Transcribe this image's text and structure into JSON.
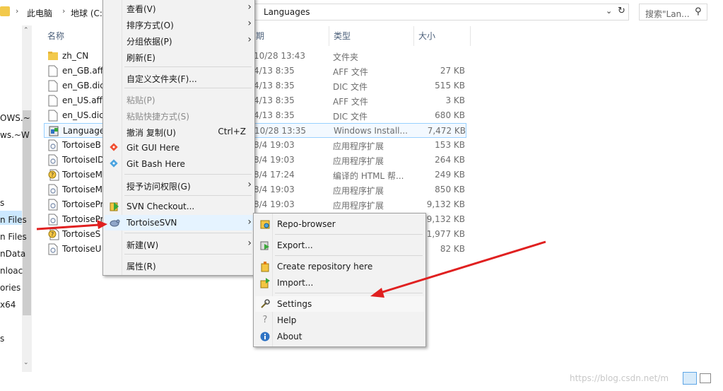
{
  "address": {
    "crumbs": [
      "此电脑",
      "地球 (C:)"
    ],
    "path_tail": "Languages",
    "search_placeholder": "搜索\"Lan..."
  },
  "nav": {
    "items": [
      "OWS.~",
      "ws.~W",
      "s",
      "n Files",
      "n Files",
      "nData",
      "nloac",
      "ories",
      "x64",
      "s"
    ]
  },
  "columns": {
    "name": "名称",
    "date": "期",
    "type": "类型",
    "size": "大小"
  },
  "files": [
    {
      "name": "zh_CN",
      "date": "10/28 13:43",
      "type": "文件夹",
      "size": "",
      "icon": "folder-icon"
    },
    {
      "name": "en_GB.aff",
      "date": "4/13 8:35",
      "type": "AFF 文件",
      "size": "27 KB",
      "icon": "file-icon"
    },
    {
      "name": "en_GB.dic",
      "date": "4/13 8:35",
      "type": "DIC 文件",
      "size": "515 KB",
      "icon": "file-icon"
    },
    {
      "name": "en_US.aff",
      "date": "4/13 8:35",
      "type": "AFF 文件",
      "size": "3 KB",
      "icon": "file-icon"
    },
    {
      "name": "en_US.dic",
      "date": "4/13 8:35",
      "type": "DIC 文件",
      "size": "680 KB",
      "icon": "file-icon"
    },
    {
      "name": "Language",
      "date": "10/28 13:35",
      "type": "Windows Install...",
      "size": "7,472 KB",
      "icon": "installer-icon"
    },
    {
      "name": "TortoiseB",
      "date": "8/4 19:03",
      "type": "应用程序扩展",
      "size": "153 KB",
      "icon": "dll-icon"
    },
    {
      "name": "TortoiseID",
      "date": "8/4 19:03",
      "type": "应用程序扩展",
      "size": "264 KB",
      "icon": "dll-icon"
    },
    {
      "name": "TortoiseM",
      "date": "8/4 17:24",
      "type": "编译的 HTML 帮...",
      "size": "249 KB",
      "icon": "chm-icon"
    },
    {
      "name": "TortoiseM",
      "date": "8/4 19:03",
      "type": "应用程序扩展",
      "size": "850 KB",
      "icon": "dll-icon"
    },
    {
      "name": "TortoisePr",
      "date": "8/4 19:03",
      "type": "应用程序扩展",
      "size": "9,132 KB",
      "icon": "dll-icon"
    },
    {
      "name": "TortoisePr",
      "date": "",
      "type": "",
      "size": "9,132 KB",
      "icon": "dll-icon"
    },
    {
      "name": "TortoiseS",
      "date": "",
      "type": "",
      "size": "1,977 KB",
      "icon": "chm-icon"
    },
    {
      "name": "TortoiseU",
      "date": "",
      "type": "",
      "size": "82 KB",
      "icon": "dll-icon"
    }
  ],
  "context_menu": {
    "items": [
      {
        "label": "查看(V)",
        "arrow": "›"
      },
      {
        "label": "排序方式(O)",
        "arrow": "›"
      },
      {
        "label": "分组依据(P)",
        "arrow": "›"
      },
      {
        "label": "刷新(E)"
      },
      {
        "label": "自定义文件夹(F)..."
      },
      {
        "label": "粘贴(P)"
      },
      {
        "label": "粘贴快捷方式(S)"
      },
      {
        "label": "撤消 复制(U)",
        "accel": "Ctrl+Z"
      },
      {
        "label": "Git GUI Here"
      },
      {
        "label": "Git Bash Here"
      },
      {
        "label": "授予访问权限(G)",
        "arrow": "›"
      },
      {
        "label": "SVN Checkout..."
      },
      {
        "label": "TortoiseSVN",
        "arrow": "›"
      },
      {
        "label": "新建(W)",
        "arrow": "›"
      },
      {
        "label": "属性(R)"
      }
    ]
  },
  "svn_menu": {
    "items": [
      {
        "label": "Repo-browser"
      },
      {
        "label": "Export..."
      },
      {
        "label": "Create repository here"
      },
      {
        "label": "Import..."
      },
      {
        "label": "Settings"
      },
      {
        "label": "Help"
      },
      {
        "label": "About"
      }
    ]
  },
  "colors": {
    "arrow": "#e02020",
    "selection": "#cce8ff",
    "hover": "#e5f3ff"
  },
  "watermark": "https://blog.csdn.net/m"
}
